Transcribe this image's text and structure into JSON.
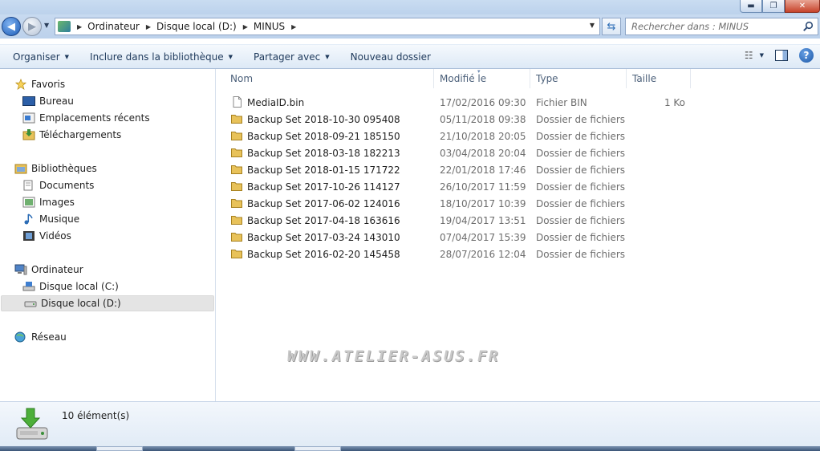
{
  "window": {
    "controls": {
      "minimize": "▬",
      "maximize": "❐",
      "close": "✕"
    }
  },
  "address": {
    "breadcrumbs": [
      "Ordinateur",
      "Disque local (D:)",
      "MINUS"
    ],
    "search_placeholder": "Rechercher dans : MINUS"
  },
  "toolbar": {
    "organize": "Organiser",
    "include_library": "Inclure dans la bibliothèque",
    "share": "Partager avec",
    "new_folder": "Nouveau dossier"
  },
  "sidebar": {
    "favorites": {
      "label": "Favoris",
      "items": [
        "Bureau",
        "Emplacements récents",
        "Téléchargements"
      ]
    },
    "libraries": {
      "label": "Bibliothèques",
      "items": [
        "Documents",
        "Images",
        "Musique",
        "Vidéos"
      ]
    },
    "computer": {
      "label": "Ordinateur",
      "items": [
        "Disque local (C:)",
        "Disque local (D:)"
      ],
      "selected": "Disque local (D:)"
    },
    "network": {
      "label": "Réseau"
    }
  },
  "columns": [
    "Nom",
    "Modifié le",
    "Type",
    "Taille"
  ],
  "files": [
    {
      "name": "MediaID.bin",
      "modified": "17/02/2016 09:30",
      "type": "Fichier BIN",
      "size": "1 Ko",
      "icon": "file-icon"
    },
    {
      "name": "Backup Set 2018-10-30 095408",
      "modified": "05/11/2018 09:38",
      "type": "Dossier de fichiers",
      "size": "",
      "icon": "folder-icon"
    },
    {
      "name": "Backup Set 2018-09-21 185150",
      "modified": "21/10/2018 20:05",
      "type": "Dossier de fichiers",
      "size": "",
      "icon": "folder-icon"
    },
    {
      "name": "Backup Set 2018-03-18 182213",
      "modified": "03/04/2018 20:04",
      "type": "Dossier de fichiers",
      "size": "",
      "icon": "folder-icon"
    },
    {
      "name": "Backup Set 2018-01-15 171722",
      "modified": "22/01/2018 17:46",
      "type": "Dossier de fichiers",
      "size": "",
      "icon": "folder-icon"
    },
    {
      "name": "Backup Set 2017-10-26 114127",
      "modified": "26/10/2017 11:59",
      "type": "Dossier de fichiers",
      "size": "",
      "icon": "folder-icon"
    },
    {
      "name": "Backup Set 2017-06-02 124016",
      "modified": "18/10/2017 10:39",
      "type": "Dossier de fichiers",
      "size": "",
      "icon": "folder-icon"
    },
    {
      "name": "Backup Set 2017-04-18 163616",
      "modified": "19/04/2017 13:51",
      "type": "Dossier de fichiers",
      "size": "",
      "icon": "folder-icon"
    },
    {
      "name": "Backup Set 2017-03-24 143010",
      "modified": "07/04/2017 15:39",
      "type": "Dossier de fichiers",
      "size": "",
      "icon": "folder-icon"
    },
    {
      "name": "Backup Set 2016-02-20 145458",
      "modified": "28/07/2016 12:04",
      "type": "Dossier de fichiers",
      "size": "",
      "icon": "folder-icon"
    }
  ],
  "watermark": "WWW.ATELIER-ASUS.FR",
  "status": {
    "count": "10 élément(s)"
  },
  "colors": {
    "folder": "#e8c25a",
    "accent": "#1c5cb8",
    "toolbar_text": "#1e395b"
  }
}
